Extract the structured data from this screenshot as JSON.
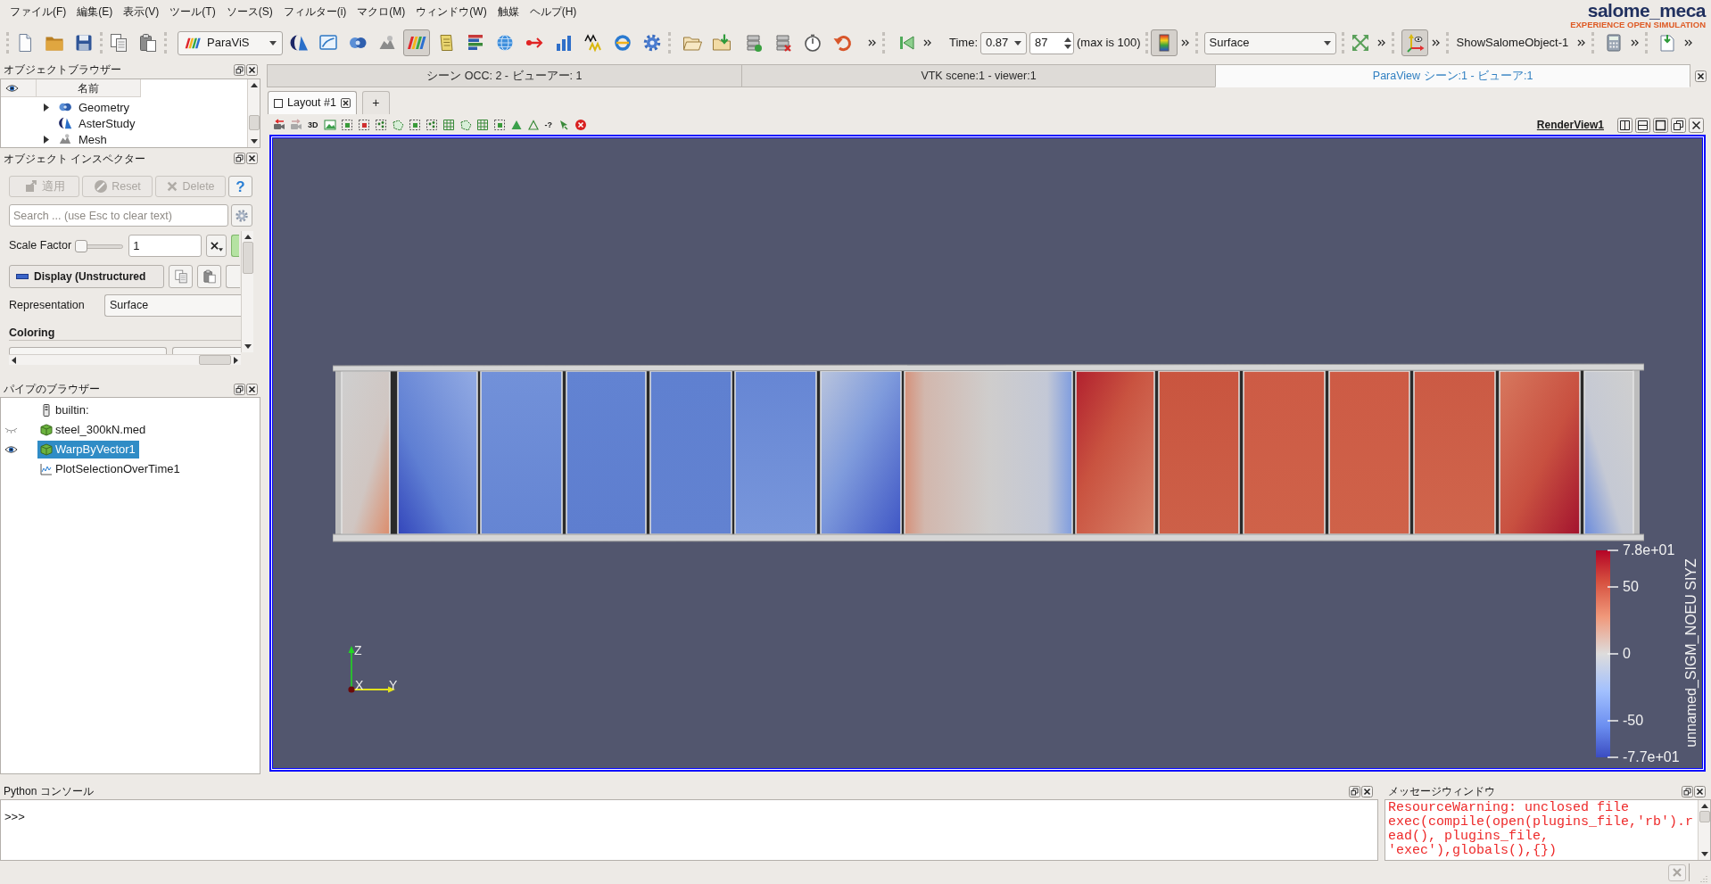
{
  "menu_bar": {
    "items": [
      "ファイル(F)",
      "編集(E)",
      "表示(V)",
      "ツール(T)",
      "ソース(S)",
      "フィルター(i)",
      "マクロ(M)",
      "ウィンドウ(W)",
      "触媒",
      "ヘルプ(H)"
    ]
  },
  "logo": {
    "name": "salome_meca",
    "tagline": "EXPERIENCE OPEN SIMULATION"
  },
  "toolbar": {
    "module": "ParaViS",
    "module_buttons": [
      {
        "on": false
      },
      {
        "on": false
      },
      {
        "on": false
      },
      {
        "on": false
      },
      {
        "on": true
      },
      {
        "on": false
      },
      {
        "on": false
      },
      {
        "on": false
      },
      {
        "on": false
      },
      {
        "on": false
      },
      {
        "on": false
      },
      {
        "on": false
      },
      {
        "on": false
      }
    ],
    "time_label": "Time:",
    "time_value": "0.87",
    "time_step": "87",
    "time_max": "(max is 100)",
    "legend_button": {
      "on": true
    },
    "representation": "Surface",
    "axes_button": {
      "on": true
    },
    "macro": "ShowSalomeObject-1"
  },
  "object_browser": {
    "title": "オブジェクトブラウザー",
    "column": "名前",
    "items": [
      {
        "label": "Geometry",
        "kind": "geometry",
        "expander": {
          "expanded": false
        }
      },
      {
        "label": "AsterStudy",
        "kind": "study"
      },
      {
        "label": "Mesh",
        "kind": "mesh",
        "expander": {
          "expanded": false
        }
      }
    ]
  },
  "object_inspector": {
    "title": "オブジェクト インスペクター",
    "buttons": [
      {
        "label": "適用",
        "disabled": true
      },
      {
        "label": "Reset",
        "disabled": true
      },
      {
        "label": "Delete",
        "disabled": true
      }
    ],
    "help": "?",
    "search_placeholder": "Search ... (use Esc to clear text)",
    "scale_factor": {
      "label": "Scale Factor",
      "level": 0,
      "value": "1"
    },
    "display": "Display (Unstructured",
    "representation": {
      "label": "Representation",
      "value": "Surface"
    },
    "section": "Coloring"
  },
  "pipeline_browser": {
    "title": "パイプのブラウザー",
    "items": [
      {
        "label": "builtin:",
        "kind": "server",
        "selected": false
      },
      {
        "label": "steel_300kN.med",
        "kind": "dataset",
        "eye": {
          "open": false
        },
        "selected": false
      },
      {
        "label": "WarpByVector1",
        "kind": "dataset",
        "eye": {
          "open": true
        },
        "selected": true
      },
      {
        "label": "PlotSelectionOverTime1",
        "kind": "plot",
        "selected": false
      }
    ]
  },
  "view_tabs": [
    {
      "label": "シーン OCC: 2 - ビューアー: 1",
      "selected": false
    },
    {
      "label": "VTK scene:1 - viewer:1",
      "selected": false
    },
    {
      "label": "ParaView シーン:1 - ビューア:1",
      "selected": true
    }
  ],
  "layout_tabs": [
    {
      "label": "Layout #1",
      "selected": true
    }
  ],
  "add_layout": "+",
  "render_view": {
    "toolbar_texts": [
      "3D",
      "-?"
    ],
    "name": "RenderView1",
    "axes": [
      "Z",
      "X",
      "Y"
    ],
    "legend": {
      "title": "unnamed_SIGM_NOEU SIYZ",
      "ticks": [
        "7.8e+01",
        "50",
        "0",
        "-50",
        "-7.7e+01"
      ]
    }
  },
  "python_console": {
    "title": "Python コンソール",
    "prompt": ">>>"
  },
  "message_window": {
    "title": "メッセージウィンドウ",
    "lines": [
      "ResourceWarning: unclosed file",
      "exec(compile(open(plugins_file,'rb').read(), plugins_file, 'exec'),globals(),{})"
    ]
  }
}
